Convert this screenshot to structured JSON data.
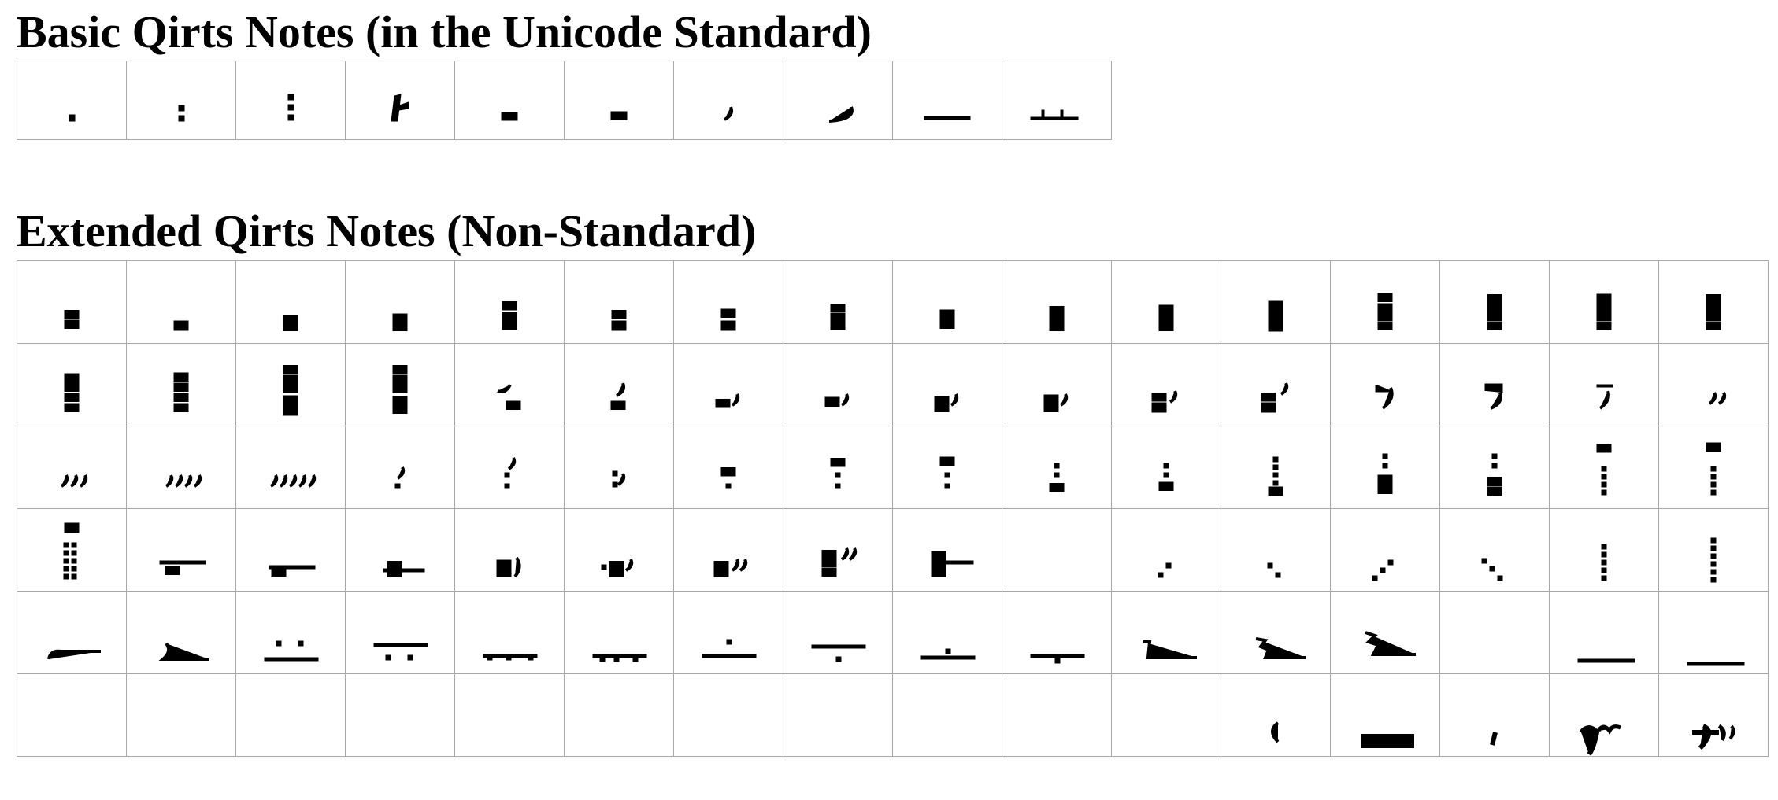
{
  "section_basic": {
    "title": "Basic Qirts Notes (in the Unicode Standard)"
  },
  "section_extended": {
    "title": "Extended Qirts Notes (Non-Standard)"
  },
  "basic_notes": [
    "dot",
    "two-dots",
    "three-dots",
    "stem-hook",
    "cup",
    "arch",
    "comma",
    "long-comma",
    "dash",
    "dash-up"
  ],
  "extended_rows": [
    [
      "cup-arch",
      "box",
      "cup-on-arch",
      "arch-arch",
      "cup-cup-arch",
      "cup-box",
      "arch-box",
      "cup-cup-on-arch",
      "box-arch",
      "cup-arch-arch",
      "arch-arch-arch",
      "box-box",
      "arch-box-arch",
      "cup-box-arch",
      "box-cup-arch",
      "cup-box-arch-2"
    ],
    [
      "box-stack-arch",
      "arch-stack-4",
      "box-stack-5",
      "cup-stack-5",
      "hook-arch",
      "hook-arch-2",
      "cup-comma",
      "box-comma",
      "cup-arch-comma",
      "arch-arch-comma",
      "cup-box-comma",
      "cup-box-comma-2",
      "cup-comma-tail",
      "arch-comma-tail",
      "bar-comma",
      "double-comma"
    ],
    [
      "triple-comma",
      "quad-comma",
      "quint-comma",
      "comma-dot",
      "comma-dots",
      "dots-comma",
      "cup-dot",
      "cup-dots",
      "arch-dots",
      "dots-cup",
      "dots-arch",
      "dots-arch-2",
      "dots-box",
      "dots-arch-arch",
      "cup-dots-long",
      "arch-dots-long"
    ],
    [
      "box-dot-grid",
      "bar-arch",
      "bar-arch-low",
      "cup-arch-bar",
      "arch-paren",
      "dot-cup-comma",
      "cup-arch-dcomma",
      "cup-arch-dcomma-2",
      "arch-bar-right",
      "",
      "dots-diag-2",
      "dots-diag-2b",
      "dots-diag-3",
      "dots-diag-3b",
      "dots-col-4",
      "dots-col-5"
    ],
    [
      "hook-dash",
      "comma-dash",
      "dash-two-dots",
      "dash-drops",
      "dash-feet",
      "dash-feet-2",
      "dash-dot",
      "dash-drop",
      "dash-base",
      "dash-drop-2",
      "step-dash",
      "zig-dash",
      "zig-dash-2",
      "",
      "long-dash",
      "long-dash-2"
    ],
    [
      "",
      "",
      "",
      "",
      "",
      "",
      "",
      "",
      "",
      "",
      "",
      "paren-open",
      "bracket",
      "tick",
      "ge-ez-mu",
      "ge-ez-phi"
    ]
  ]
}
